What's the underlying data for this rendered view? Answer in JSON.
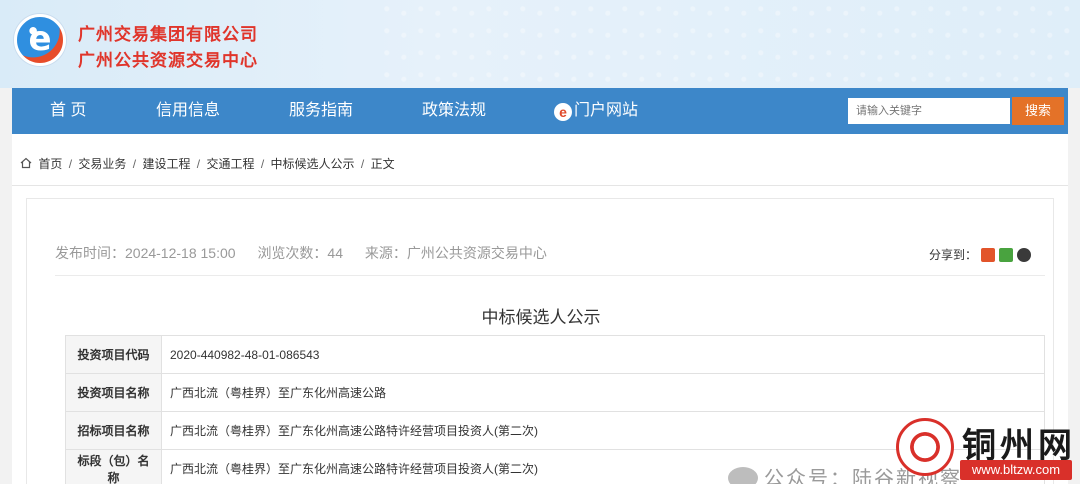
{
  "header": {
    "logo_letter": "e",
    "org_name_1": "广州交易集团有限公司",
    "org_name_2": "广州公共资源交易中心"
  },
  "nav": {
    "items": [
      "首 页",
      "信用信息",
      "服务指南",
      "政策法规",
      "门户网站"
    ],
    "portal_icon_letter": "e",
    "search_placeholder": "请输入关键字",
    "search_button": "搜索"
  },
  "breadcrumb": {
    "items": [
      "首页",
      "交易业务",
      "建设工程",
      "交通工程",
      "中标候选人公示",
      "正文"
    ],
    "separator": "/"
  },
  "article": {
    "publish_time": "发布时间：2024-12-18 15:00",
    "views": "浏览次数：44",
    "source": "来源：广州公共资源交易中心",
    "share_label": "分享到：",
    "title": "中标候选人公示"
  },
  "table": {
    "rows": [
      {
        "key": "投资项目代码",
        "value": "2020-440982-48-01-086543"
      },
      {
        "key": "投资项目名称",
        "value": "广西北流（粤桂界）至广东化州高速公路"
      },
      {
        "key": "招标项目名称",
        "value": "广西北流（粤桂界）至广东化州高速公路特许经营项目投资人(第二次)"
      },
      {
        "key": "标段（包）名称",
        "value": "广西北流（粤桂界）至广东化州高速公路特许经营项目投资人(第二次)"
      }
    ]
  },
  "watermark": {
    "site": "铜州网",
    "url": "www.bltzw.com",
    "gzh_text": "公众号：陆谷新视察"
  },
  "colors": {
    "nav_bg": "#3d87c9",
    "search_button": "#e47228",
    "brand_red": "#e0352b"
  }
}
